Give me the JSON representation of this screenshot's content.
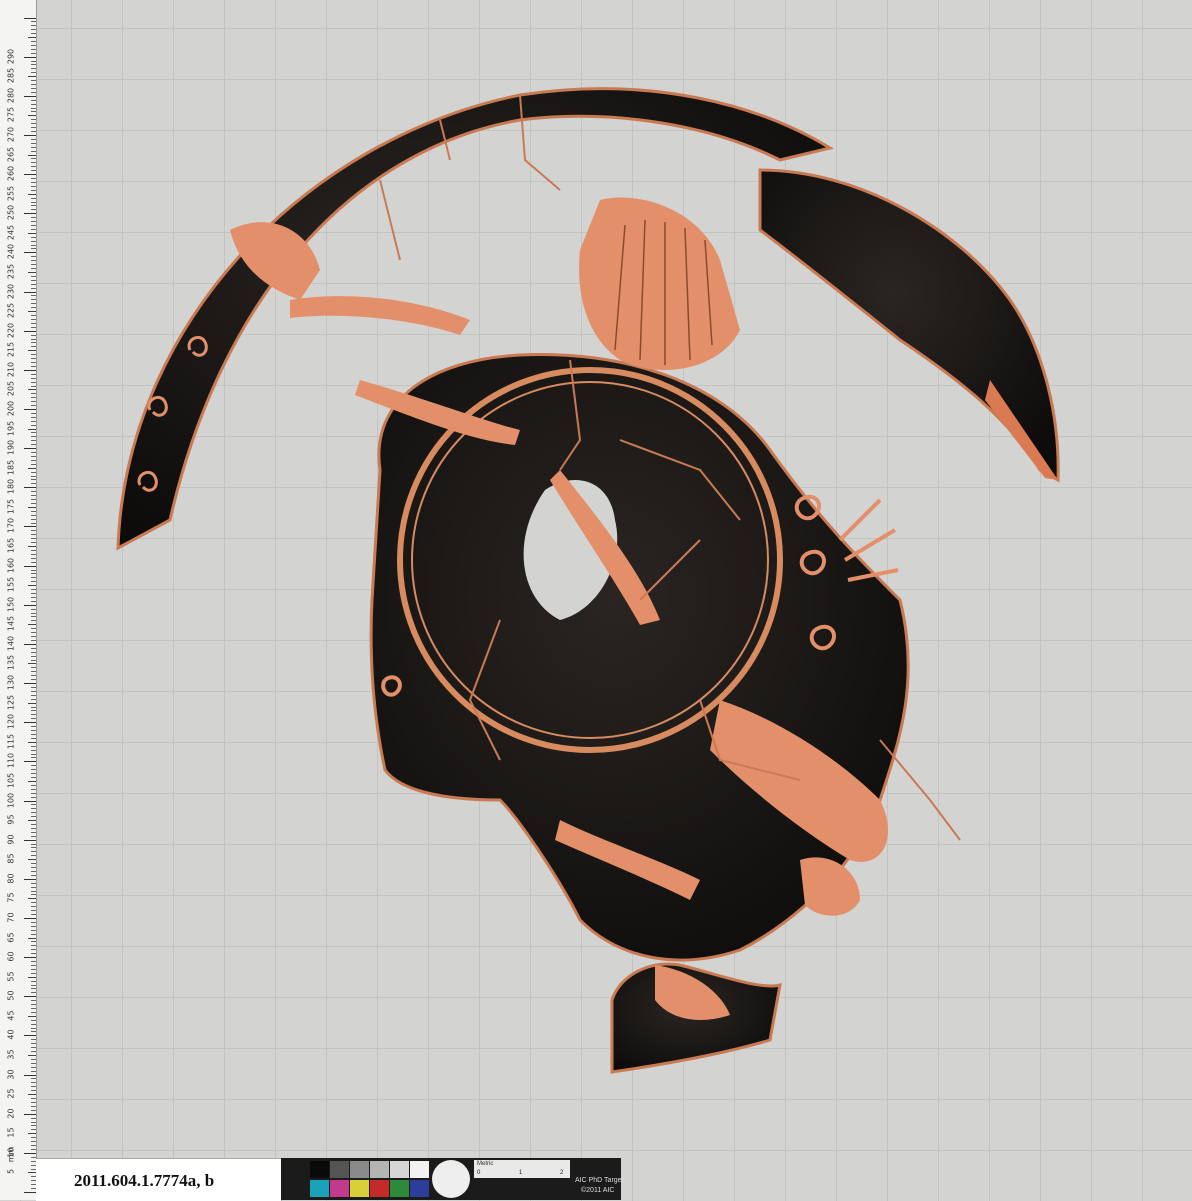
{
  "ruler": {
    "unit": "mm",
    "labels": [
      "5",
      "10",
      "15",
      "20",
      "25",
      "30",
      "35",
      "40",
      "45",
      "50",
      "55",
      "60",
      "65",
      "70",
      "75",
      "80",
      "85",
      "90",
      "95",
      "100",
      "105",
      "110",
      "115",
      "120",
      "125",
      "130",
      "135",
      "140",
      "145",
      "150",
      "155",
      "160",
      "165",
      "170",
      "175",
      "180",
      "185",
      "190",
      "195",
      "200",
      "205",
      "210",
      "215",
      "220",
      "225",
      "230",
      "235",
      "240",
      "245",
      "250",
      "255",
      "260",
      "265",
      "270",
      "275",
      "280",
      "285",
      "290"
    ]
  },
  "label_card": {
    "accession": "2011.604.1.7774a, b"
  },
  "target_card": {
    "metric_label": "Metric",
    "metric_marks": [
      "0",
      "1",
      "2"
    ],
    "line1": "AIC PhD Target",
    "line2": "©2011 AIC",
    "swatch_colors_top": [
      "#0a0a0a",
      "#555555",
      "#8a8a8a",
      "#b4b4b4",
      "#d6d6d6",
      "#f2f2f2"
    ],
    "swatch_colors_bottom": [
      "#1aa3b8",
      "#c23a8b",
      "#d8d038",
      "#c52a2a",
      "#2e8a3a",
      "#2d3e9a"
    ]
  },
  "colors": {
    "background": "#d3d4d2",
    "grid": "#c3c4c2",
    "clay": "#e08a5e",
    "glaze": "#121110"
  }
}
